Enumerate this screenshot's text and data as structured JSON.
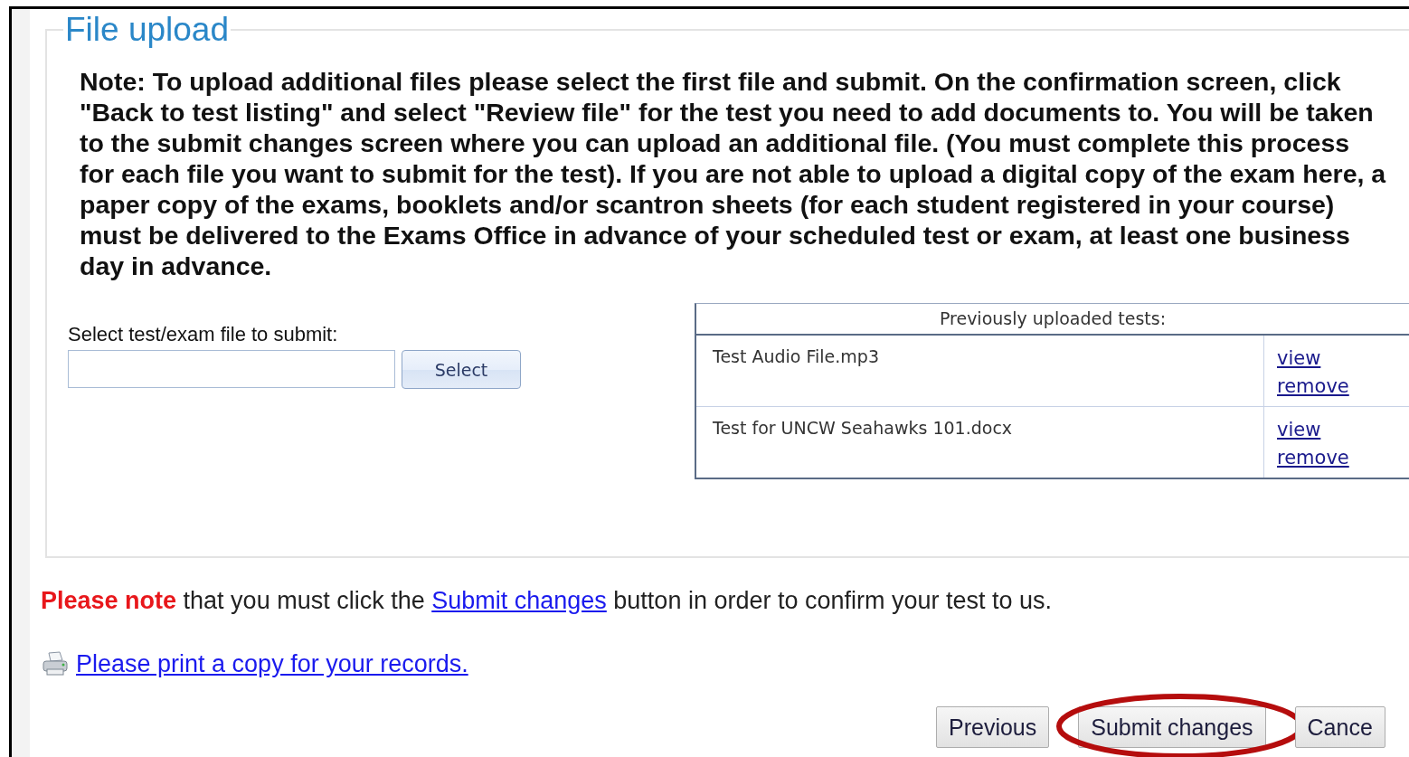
{
  "section": {
    "legend": "File upload",
    "note": "Note: To upload additional files please select the first file and submit. On the confirmation screen, click \"Back to test listing\" and select \"Review file\" for the test you need to add documents to. You will be taken to the submit changes screen where you can upload an additional file. (You must complete this process for each file you want to submit for the test). If you are not able to upload a digital copy of the exam here, a paper copy of the exams, booklets and/or scantron sheets (for each student registered in your course) must be delivered to the Exams Office in advance of your scheduled test or exam, at least one business day in advance."
  },
  "file_select": {
    "label": "Select test/exam file to submit:",
    "button": "Select"
  },
  "uploaded_tests": {
    "header": "Previously uploaded tests:",
    "rows": [
      {
        "file": "Test Audio File.mp3",
        "actions": [
          "view",
          "remove"
        ]
      },
      {
        "file": "Test for UNCW Seahawks 101.docx",
        "actions": [
          "view",
          "remove"
        ]
      }
    ]
  },
  "notice": {
    "emphasis": "Please note",
    "before_link": "that you must click the",
    "link": "Submit changes",
    "after_link": "button in order to confirm your test to us."
  },
  "print_link": "Please print a copy for your records.",
  "buttons": [
    {
      "label": "Previous",
      "circled": false
    },
    {
      "label": "Submit changes",
      "circled": true
    },
    {
      "label": "Cance",
      "circled": false
    }
  ]
}
